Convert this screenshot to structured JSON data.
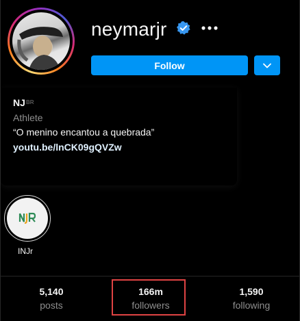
{
  "profile": {
    "username": "neymarjr",
    "verified": true,
    "more_icon": "more-horizontal-icon"
  },
  "actions": {
    "follow_label": "Follow",
    "dropdown_icon": "chevron-down-icon"
  },
  "bio": {
    "name": "NJ",
    "flag_text": "BR",
    "category": "Athlete",
    "quote": "“O menino encantou a quebrada”",
    "link": "youtu.be/lnCK09gQVZw"
  },
  "highlights": [
    {
      "label": "INJr",
      "logo_text": "NJR"
    }
  ],
  "stats": {
    "posts": {
      "value": "5,140",
      "label": "posts"
    },
    "followers": {
      "value": "166m",
      "label": "followers"
    },
    "following": {
      "value": "1,590",
      "label": "following"
    }
  },
  "colors": {
    "background": "#000000",
    "primary_button": "#0095f6",
    "verified_badge": "#3897f0",
    "annotation_box": "#e04343",
    "secondary_text": "#8e8e8e"
  }
}
